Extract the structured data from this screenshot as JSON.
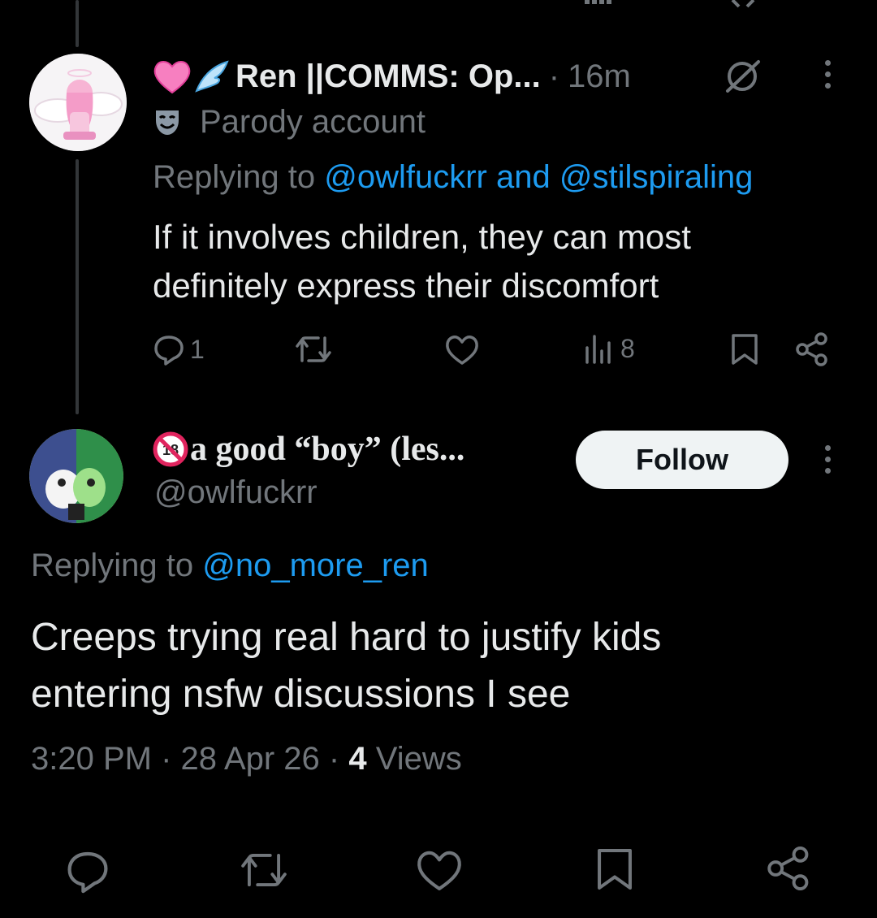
{
  "reply_tweet": {
    "display_name": "Ren ||COMMS: Op...",
    "time": "16m",
    "separator": "·",
    "badge_label": "Parody account",
    "replying_prefix": "Replying to",
    "replying_to_1": "@owlfuckrr",
    "replying_and": "and",
    "replying_to_2": "@stilspiraling",
    "text_line1": "If it involves children, they can most",
    "text_line2": "definitely express their discomfort",
    "reply_count": "1",
    "views_count": "8"
  },
  "main_tweet": {
    "display_name": "a good “boy” (les...",
    "handle": "@owlfuckrr",
    "follow_label": "Follow",
    "replying_prefix": "Replying to",
    "replying_to": "@no_more_ren",
    "text_line1": "Creeps trying real hard to justify kids",
    "text_line2": "entering nsfw discussions I see",
    "time": "3:20 PM",
    "date": "28 Apr 26",
    "views_count": "4",
    "views_label": "Views",
    "separator": "·"
  },
  "icons": {
    "reply": "reply-icon",
    "retweet": "retweet-icon",
    "like": "heart-icon",
    "views": "views-icon",
    "bookmark": "bookmark-icon",
    "share": "share-icon",
    "more": "more-icon",
    "grok": "grok-icon",
    "parody": "mask-icon"
  },
  "colors": {
    "background": "#000000",
    "text": "#e7e9ea",
    "muted": "#71767b",
    "link": "#1d9bf0"
  }
}
